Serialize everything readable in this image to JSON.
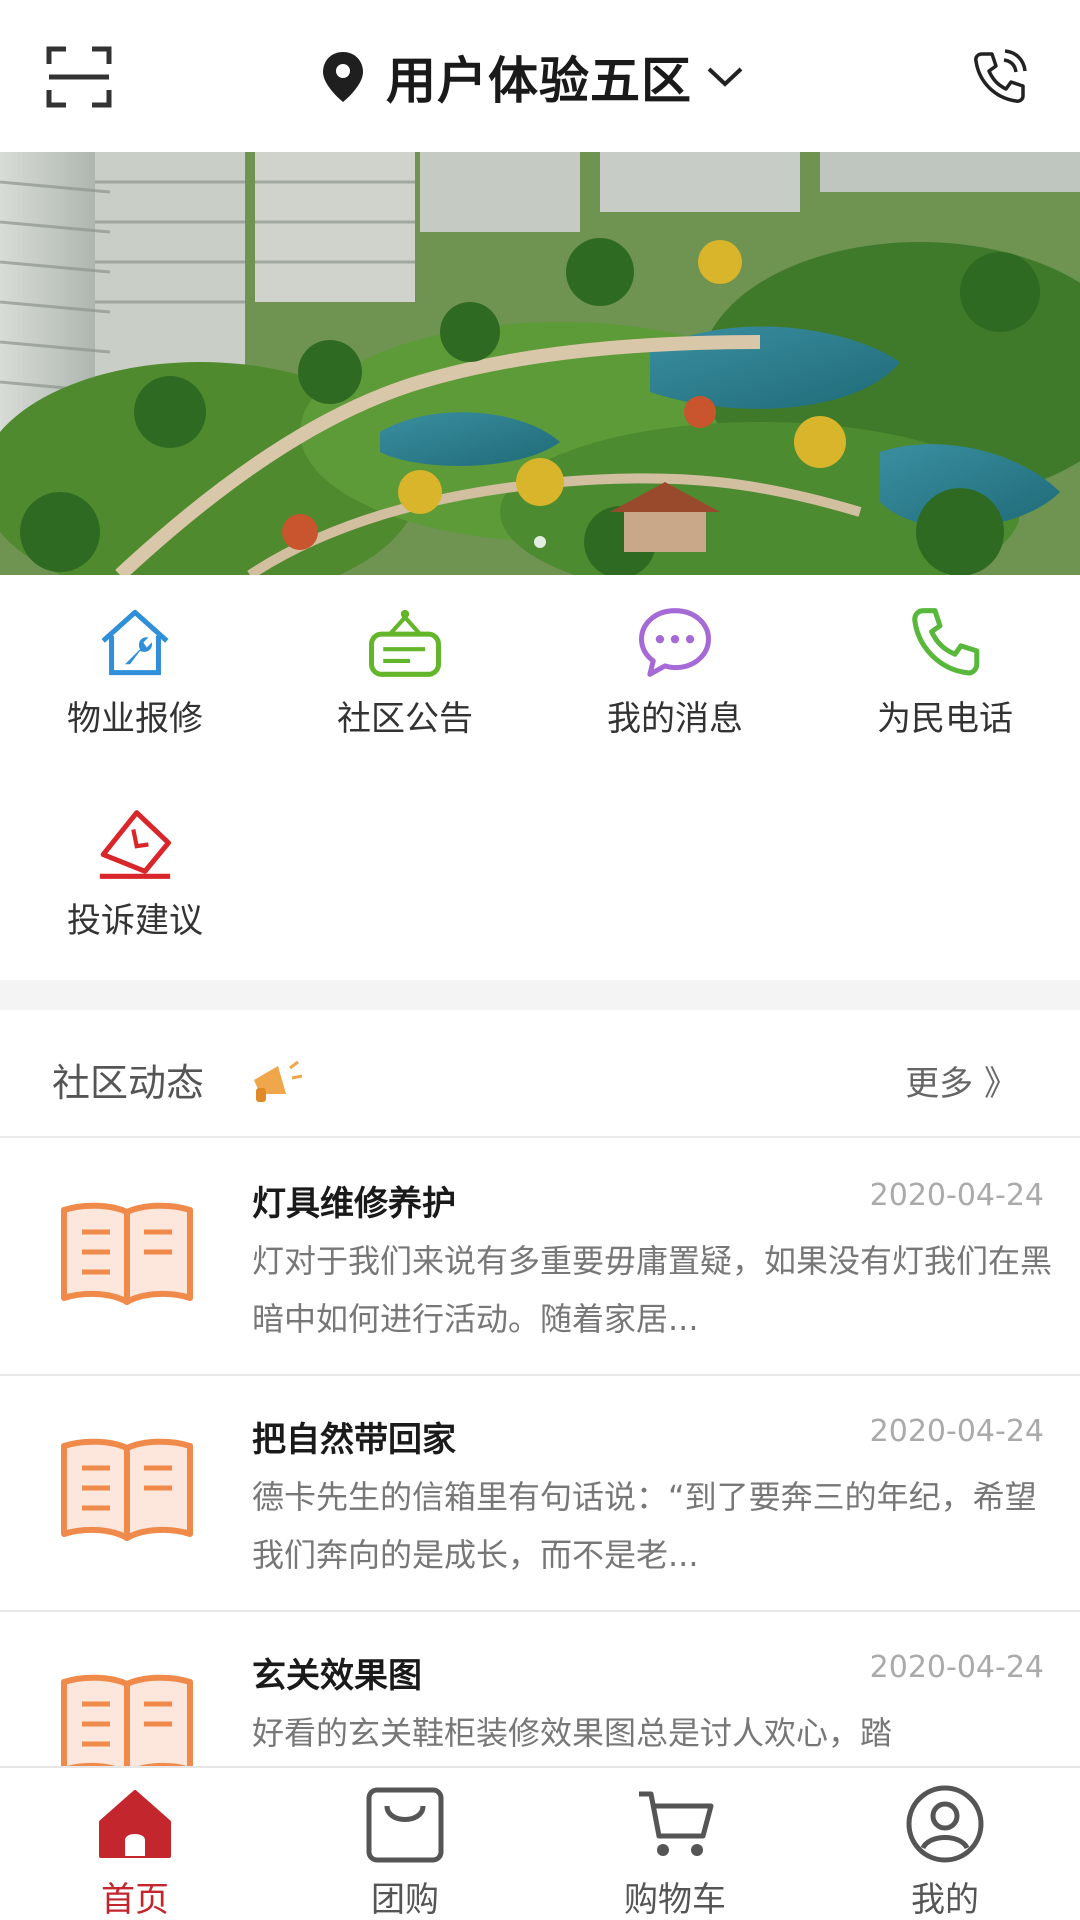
{
  "header": {
    "location": "用户体验五区"
  },
  "quick_menu": [
    {
      "label": "物业报修",
      "icon": "repair-house-icon",
      "color": "#2f8fd8"
    },
    {
      "label": "社区公告",
      "icon": "notice-board-icon",
      "color": "#63b52a"
    },
    {
      "label": "我的消息",
      "icon": "chat-bubble-icon",
      "color": "#a66ad6"
    },
    {
      "label": "为民电话",
      "icon": "phone-icon",
      "color": "#58b83b"
    },
    {
      "label": "投诉建议",
      "icon": "complaint-mail-icon",
      "color": "#d9262b"
    }
  ],
  "news": {
    "title": "社区动态",
    "more": "更多 》",
    "items": [
      {
        "title": "灯具维修养护",
        "date": "2020-04-24",
        "desc": "灯对于我们来说有多重要毋庸置疑，如果没有灯我们在黑暗中如何进行活动。随着家居..."
      },
      {
        "title": "把自然带回家",
        "date": "2020-04-24",
        "desc": "德卡先生的信箱里有句话说：“到了要奔三的年纪，希望我们奔向的是成长，而不是老..."
      },
      {
        "title": "玄关效果图",
        "date": "2020-04-24",
        "desc": "好看的玄关鞋柜装修效果图总是讨人欢心，踏"
      }
    ]
  },
  "tabbar": [
    {
      "label": "首页",
      "icon": "home-icon",
      "active": true
    },
    {
      "label": "团购",
      "icon": "shopping-bag-icon",
      "active": false
    },
    {
      "label": "购物车",
      "icon": "cart-icon",
      "active": false
    },
    {
      "label": "我的",
      "icon": "user-icon",
      "active": false
    }
  ],
  "colors": {
    "accent": "#c4262e",
    "book": "#f08a4b"
  }
}
